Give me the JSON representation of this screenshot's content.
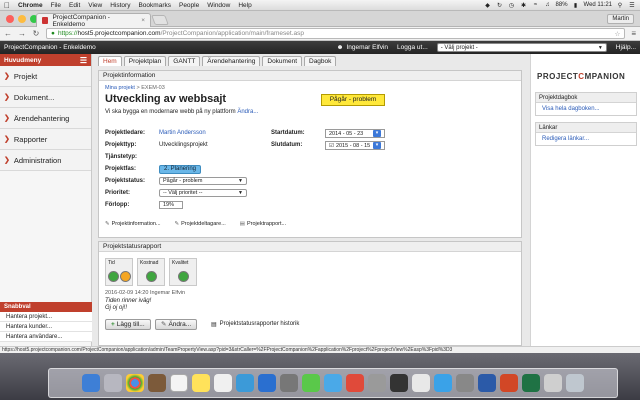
{
  "menubar": {
    "app": "Chrome",
    "items": [
      "File",
      "Edit",
      "View",
      "History",
      "Bookmarks",
      "People",
      "Window",
      "Help"
    ],
    "battery": "88%",
    "clock": "Wed 11:21"
  },
  "browser": {
    "tab_title": "ProjectCompanion - Enkeldemo",
    "profile": "Martin",
    "url_scheme": "https://",
    "url_host": "host5.projectcompanion.com",
    "url_path": "/ProjectCompanion/application/main/frameset.asp"
  },
  "header": {
    "title": "ProjectCompanion - Enkeldemo",
    "user": "Ingemar Elfvin",
    "logout": "Logga ut...",
    "project_select": "- Välj projekt -",
    "help": "Hjälp..."
  },
  "sidebar": {
    "head": "Huvudmeny",
    "items": [
      "Projekt",
      "Dokument...",
      "Ärendehantering",
      "Rapporter",
      "Administration"
    ],
    "quick_head": "Snabbval",
    "quick_links": [
      "Hantera projekt...",
      "Hantera kunder...",
      "Hantera användare..."
    ]
  },
  "tabs": [
    "Hem",
    "Projektplan",
    "GANTT",
    "Ärendehantering",
    "Dokument",
    "Dagbok"
  ],
  "project": {
    "panel_title": "Projektinformation",
    "crumb_link": "Mina projekt",
    "crumb_sep": ">",
    "crumb_code": "EXEM-03",
    "title": "Utveckling av webbsajt",
    "status_badge": "Pågår - problem",
    "description": "Vi ska bygga en modernare webb på ny plattform",
    "description_link": "Ändra...",
    "labels": {
      "leader": "Projektledare:",
      "type": "Projekttyp:",
      "service": "Tjänstetyp:",
      "phase": "Projektfas:",
      "status": "Projektstatus:",
      "priority": "Prioritet:",
      "progress": "Förlopp:",
      "start": "Startdatum:",
      "end": "Slutdatum:"
    },
    "leader": "Martin Andersson",
    "type": "Utvecklingsprojekt",
    "phase": "2. Planering",
    "status_value": "Pågår - problem",
    "priority_value": "-- Välj prioritet --",
    "progress": "19%",
    "start_date": "2014 - 05 - 23",
    "end_date": "2015 - 08 - 15",
    "actions": [
      "Projektinformation...",
      "Projektdeltagare...",
      "Projektrapport..."
    ]
  },
  "status_report": {
    "panel_title": "Projektstatusrapport",
    "cards": [
      {
        "label": "Tid",
        "colors": [
          "#3fa63f",
          "#f4a623"
        ]
      },
      {
        "label": "Kostnad",
        "colors": [
          "#3fa63f"
        ]
      },
      {
        "label": "Kvalitet",
        "colors": [
          "#3fa63f"
        ]
      }
    ],
    "meta": "2016-02-09 14:20 Ingemar Elfvin",
    "text_line1": "Tiden rinner iväg!",
    "text_line2": "Gj oj oj!!",
    "add_button": "Lägg till...",
    "edit_button": "Ändra...",
    "history_link": "Projektstatusrapporter historik"
  },
  "right": {
    "logo_a": "PROJECT",
    "logo_b": "C",
    "logo_c": "MPANION",
    "diary_head": "Projektdagbok",
    "diary_link": "Visa hela dagboken...",
    "links_head": "Länkar",
    "links_link": "Redigera länkar..."
  },
  "status_url": "https://host5.projectcompanion.com/ProjectCompanion/application/admin/TeamPropertyView.asp?pid=3&strCaller=%2FProjectCompanion%2Fapplication%2Fproject%2FprojectView%2Easp%3Fpid%3D3",
  "colors": {
    "accent": "#c0402d",
    "badge": "#ffe83a"
  }
}
